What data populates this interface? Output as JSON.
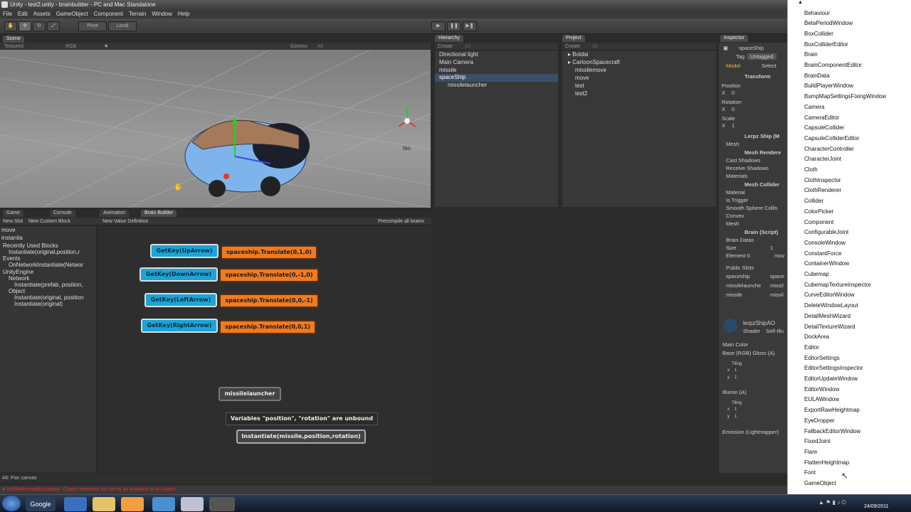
{
  "window": {
    "title": "Unity - test2.unity - brainbuilder - PC and Mac Standalone"
  },
  "menu": [
    "File",
    "Edit",
    "Assets",
    "GameObject",
    "Component",
    "Terrain",
    "Window",
    "Help"
  ],
  "toolbar": {
    "pivot": "Pivot",
    "local": "Local"
  },
  "scene": {
    "tab": "Scene",
    "shading": "Textured",
    "render": "RGB",
    "gizmos": "Gizmos",
    "gizmos_all": "All",
    "iso": "Iso"
  },
  "hierarchy": {
    "tab": "Hierarchy",
    "create": "Create",
    "search": "All",
    "items": [
      "Directional light",
      "Main Camera",
      "missile",
      "spaceShip",
      "missilelauncher"
    ]
  },
  "project": {
    "tab": "Project",
    "create": "Create",
    "search": "All",
    "items": [
      "Boldai",
      "CartoonSpacecraft",
      "missilemove",
      "move",
      "test",
      "test2"
    ]
  },
  "inspector": {
    "tab": "Inspector",
    "object_name": "spaceShip",
    "tag_label": "Tag",
    "tag_value": "Untagged",
    "model_label": "Model",
    "model_btn": "Select",
    "transform": "Transform",
    "position": "Position",
    "position_x": "X",
    "position_x_val": "0",
    "rotation": "Rotation",
    "rotation_x": "X",
    "rotation_x_val": "0",
    "scale": "Scale",
    "scale_x": "X",
    "scale_x_val": "1",
    "lerpz_ship": "Lerpz Ship (M",
    "mesh": "Mesh",
    "mesh_renderer": "Mesh Rendere",
    "cast_shadows": "Cast Shadows",
    "receive_shadows": "Receive Shadows",
    "materials": "Materials",
    "mesh_collider": "Mesh Collider",
    "material": "Material",
    "is_trigger": "Is Trigger",
    "smooth_sphere": "Smooth Sphere Collis",
    "convex": "Convex",
    "mesh2": "Mesh",
    "brain_script": "Brain (Script)",
    "brain_datas": "Brain Datas",
    "size": "Size",
    "size_val": "1",
    "element0": "Element 0",
    "element0_val": "mov",
    "public_slots": "Public Slots",
    "slot_spaceship": "spaceship",
    "slot_spaceship_val": "space",
    "slot_missilelauncher": "missilelaunche",
    "slot_missilelauncher_val": "missil",
    "slot_missile": "missile",
    "slot_missile_val": "missil",
    "shader_name": "lerpzShipAO",
    "shader_label": "Shader",
    "shader_val": "Self-Illu",
    "main_color": "Main Color",
    "base_gloss": "Base (RGB) Gloss (A)",
    "tiling": "Tiling",
    "tiling_x": "x",
    "tiling_x_val": "1",
    "tiling_y": "y",
    "tiling_y_val": "1",
    "illumin": "Illumin (A)",
    "tiling2": "Tiling",
    "tiling2_x": "x",
    "tiling2_x_val": "1",
    "tiling2_y": "y",
    "tiling2_y_val": "1",
    "emission": "Emission (Lightmapper)"
  },
  "bottom_tabs": [
    "Game",
    "Console",
    "Animation",
    "Brain Builder"
  ],
  "brain_builder": {
    "new_slot": "New Slot",
    "new_custom_block": "New Custom Block",
    "new_value_def": "New Value Definition",
    "precompile": "Precompile all brains",
    "list_header1": "move",
    "list_header2": "instantia",
    "tree": [
      "Recently Used Blocks",
      "Instantiate(original,position,r",
      "Events",
      "OnNetworkInstantiate(Networ",
      "UnityEngine",
      "Network",
      "Instantiate(prefab, position,",
      "Object",
      "Instantiate(original, position",
      "Instantiate(original)"
    ],
    "blocks": {
      "up_key": "GetKey(UpArrow)",
      "up_action": "spaceship.Translate(0,1,0)",
      "down_key": "GetKey(DownArrow)",
      "down_action": "spaceship.Translate(0,-1,0)",
      "left_key": "GetKey(LeftArrow)",
      "left_action": "spaceship.Translate(0,0,-1)",
      "right_key": "GetKey(RightArrow)",
      "right_action": "spaceship.Translate(0,0,1)",
      "missilelauncher": "missilelauncher",
      "warning": "Variables \"position\", \"rotation\" are unbound",
      "instantiate": "Instantiate(missile,position,rotation)"
    }
  },
  "status": {
    "hint": "Alt: Pan canvas",
    "error": "NullReferenceException: Object reference not set to an instance of an object"
  },
  "dropdown": {
    "items": [
      "Behaviour",
      "BetaPeriodWindow",
      "BoxCollider",
      "BoxColliderEditor",
      "Brain",
      "BrainComponentEditor",
      "BrainData",
      "BuildPlayerWindow",
      "BumpMapSettingsFixingWindow",
      "Camera",
      "CameraEditor",
      "CapsuleCollider",
      "CapsuleColliderEditor",
      "CharacterController",
      "CharacterJoint",
      "Cloth",
      "ClothInspector",
      "ClothRenderer",
      "Collider",
      "ColorPicker",
      "Component",
      "ConfigurableJoint",
      "ConsoleWindow",
      "ConstantForce",
      "ContainerWindow",
      "Cubemap",
      "CubemapTextureInspector",
      "CurveEditorWindow",
      "DeleteWindowLayout",
      "DetailMeshWizard",
      "DetailTextureWizard",
      "DockArea",
      "Editor",
      "EditorSettings",
      "EditorSettingsInspector",
      "EditorUpdateWindow",
      "EditorWindow",
      "EULAWindow",
      "ExportRawHeightmap",
      "EyeDropper",
      "FallbackEditorWindow",
      "FixedJoint",
      "Flare",
      "FlattenHeightmap",
      "Font",
      "GameObject"
    ]
  },
  "taskbar": {
    "google": "Google",
    "date": "24/09/2011"
  }
}
